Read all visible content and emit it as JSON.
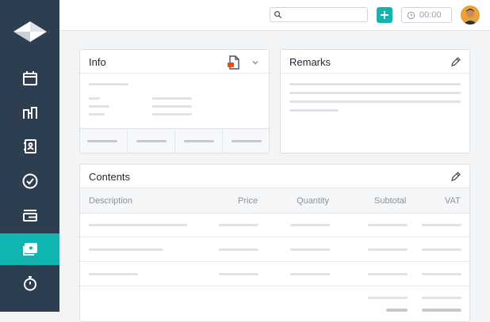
{
  "sidebar": {
    "logo_icon": "app-logo",
    "items": [
      {
        "icon": "calendar-icon",
        "active": false
      },
      {
        "icon": "team-icon",
        "active": false
      },
      {
        "icon": "contacts-icon",
        "active": false
      },
      {
        "icon": "checkmark-circle-icon",
        "active": false
      },
      {
        "icon": "projects-icon",
        "active": false
      },
      {
        "icon": "invoices-icon",
        "active": true
      },
      {
        "icon": "stopwatch-icon",
        "active": false
      }
    ]
  },
  "topbar": {
    "search_placeholder": "",
    "add_label": "+",
    "timer_value": "00:00"
  },
  "info_card": {
    "title": "Info"
  },
  "remarks_card": {
    "title": "Remarks"
  },
  "contents_card": {
    "title": "Contents",
    "columns": [
      "Description",
      "Price",
      "Quantity",
      "Subtotal",
      "VAT"
    ]
  },
  "colors": {
    "accent": "#11b5b0",
    "sidebar_bg": "#2c3e50",
    "pdf_icon_accent": "#d9540f"
  }
}
